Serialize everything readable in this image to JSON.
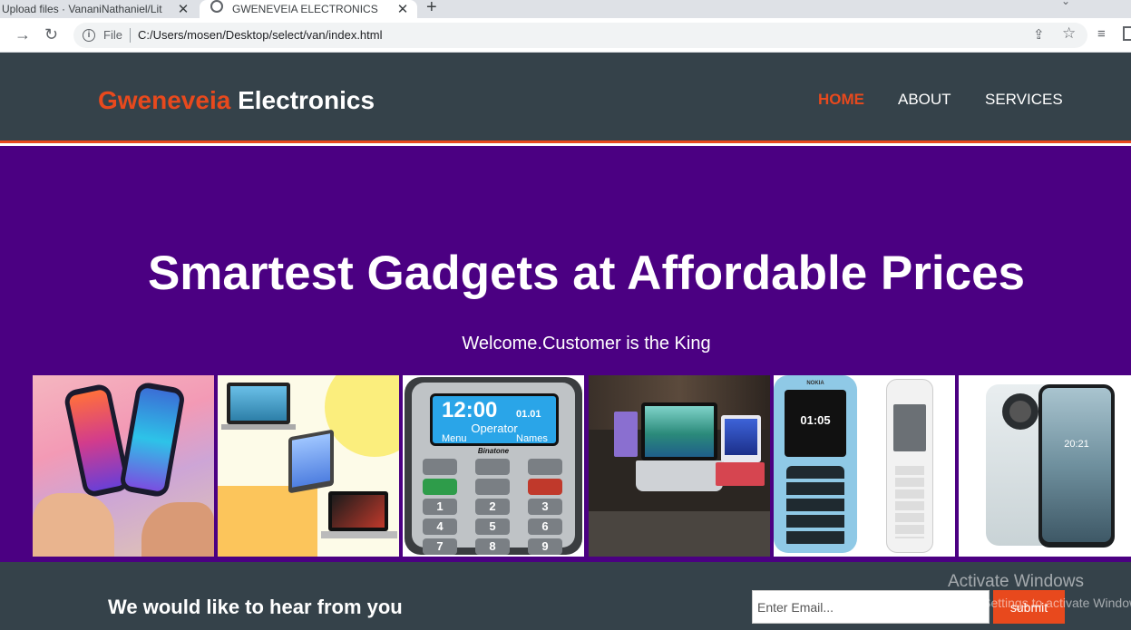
{
  "browser": {
    "tabs": [
      {
        "title": "Upload files · VananiNathaniel/Lit"
      },
      {
        "title": "GWENEVEIA ELECTRONICS"
      }
    ],
    "file_label": "File",
    "url": "C:/Users/mosen/Desktop/select/van/index.html"
  },
  "site": {
    "brand_accent": "Gweneveia",
    "brand_rest": "Electronics",
    "nav": [
      {
        "label": "HOME",
        "current": true
      },
      {
        "label": "ABOUT",
        "current": false
      },
      {
        "label": "SERVICES",
        "current": false
      }
    ]
  },
  "showcase": {
    "heading": "Smartest Gadgets at Affordable Prices",
    "tagline": "Welcome.Customer is the King",
    "product_images": [
      {
        "icon": "smartphones-image"
      },
      {
        "icon": "laptops-tablet-image"
      },
      {
        "icon": "keypad-phone-image",
        "screen_time": "12:00",
        "screen_date": "01.01",
        "screen_operator": "Operator",
        "softkeys": [
          "Menu",
          "Names"
        ],
        "brand": "Binatone"
      },
      {
        "icon": "laptop-desk-image"
      },
      {
        "icon": "feature-phones-image",
        "screen_time": "01:05",
        "brand": "NOKIA"
      },
      {
        "icon": "nokia-smartphone-image",
        "screen_time": "20:21"
      }
    ]
  },
  "newsletter": {
    "heading": "We would like to hear from you",
    "email_placeholder": "Enter Email...",
    "submit_label": "submit"
  },
  "os_watermark": {
    "line1": "Activate Windows",
    "line2": "Go to Settings to activate Windows."
  },
  "colors": {
    "accent": "#e8491d",
    "header_bg": "#35424a",
    "showcase_bg": "#4b0082"
  }
}
